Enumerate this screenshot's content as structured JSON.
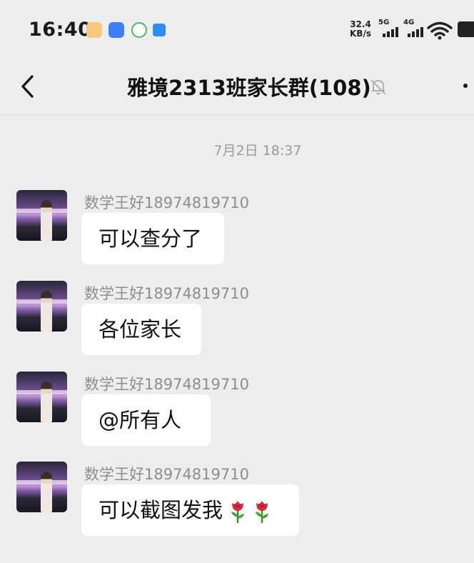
{
  "status_bar": {
    "time": "16:40",
    "net_speed_value": "32.4",
    "net_speed_unit": "KB/s",
    "sim1_label": "5G",
    "sim2_label": "4G",
    "notification_icons": [
      "taobao-icon",
      "browser-icon",
      "recycle-icon",
      "app-icon"
    ]
  },
  "header": {
    "title": "雅境2313班家长群(108)",
    "icons": [
      "back-icon",
      "mute-bell-icon",
      "more-icon"
    ]
  },
  "chat": {
    "timestamp": "7月2日 18:37",
    "messages": [
      {
        "sender": "数学王好18974819710",
        "text": "可以查分了"
      },
      {
        "sender": "数学王好18974819710",
        "text": "各位家长"
      },
      {
        "sender": "数学王好18974819710",
        "text": "@所有人"
      },
      {
        "sender": "数学王好18974819710",
        "text": "可以截图发我",
        "emoji": [
          "rose-icon",
          "rose-icon"
        ]
      }
    ]
  },
  "colors": {
    "background": "#ededed",
    "bubble": "#ffffff",
    "sender_text": "#8e8e8e",
    "timestamp_text": "#9a9a9a"
  }
}
